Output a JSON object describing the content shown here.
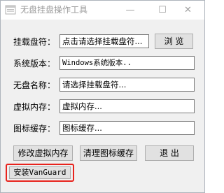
{
  "window": {
    "title": "无盘挂盘操作工具",
    "minimize_glyph": "—",
    "maximize_glyph": "☐",
    "close_glyph": "✕"
  },
  "rows": [
    {
      "label": "挂载盘符：",
      "value": "点击请选择挂载盘符..."
    },
    {
      "label": "系统版本：",
      "value": "Windows系统版本.."
    },
    {
      "label": "无盘名称：",
      "value": "请选择挂载盘符..."
    },
    {
      "label": "虚拟内存：",
      "value": "虚拟内存..."
    },
    {
      "label": "图标缓存：",
      "value": "图标缓存..."
    }
  ],
  "buttons": {
    "browse": "浏 览",
    "modify_virtual_memory": "修改虚拟内存",
    "clear_icon_cache": "清理图标缓存",
    "exit": "退  出",
    "install_vanguard": "安装VanGuard"
  },
  "colors": {
    "highlight_border": "#e8231d",
    "window_bg": "#f0f0f0"
  },
  "icons": {
    "app_icon": "window-app-icon"
  }
}
